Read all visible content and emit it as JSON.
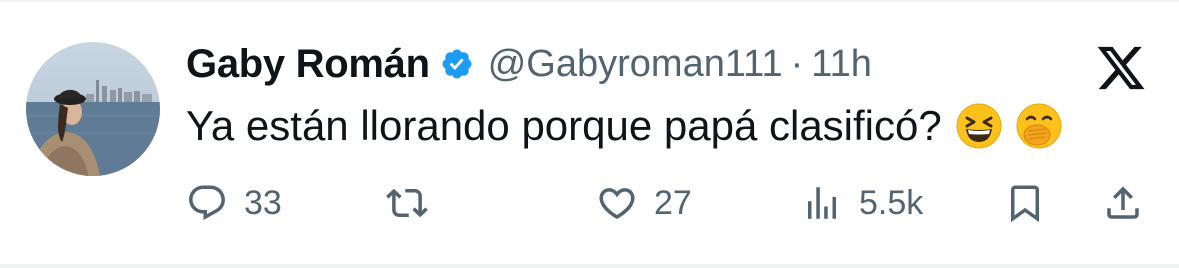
{
  "tweet": {
    "author_name": "Gaby Román",
    "handle": "@Gabyroman111",
    "separator": "·",
    "time": "11h",
    "text": "Ya están llorando porque papá clasificó?",
    "emojis": [
      "grinning-squinting-face",
      "face-with-hand-over-mouth"
    ]
  },
  "actions": {
    "replies": "33",
    "retweets": "",
    "likes": "27",
    "views": "5.5k"
  },
  "colors": {
    "text": "#0f1419",
    "secondary": "#536471",
    "verified": "#1d9bf0",
    "border": "#eff3f4"
  },
  "icons": [
    "reply-icon",
    "retweet-icon",
    "like-icon",
    "views-icon",
    "bookmark-icon",
    "share-icon",
    "x-logo-icon",
    "verified-badge-icon"
  ]
}
